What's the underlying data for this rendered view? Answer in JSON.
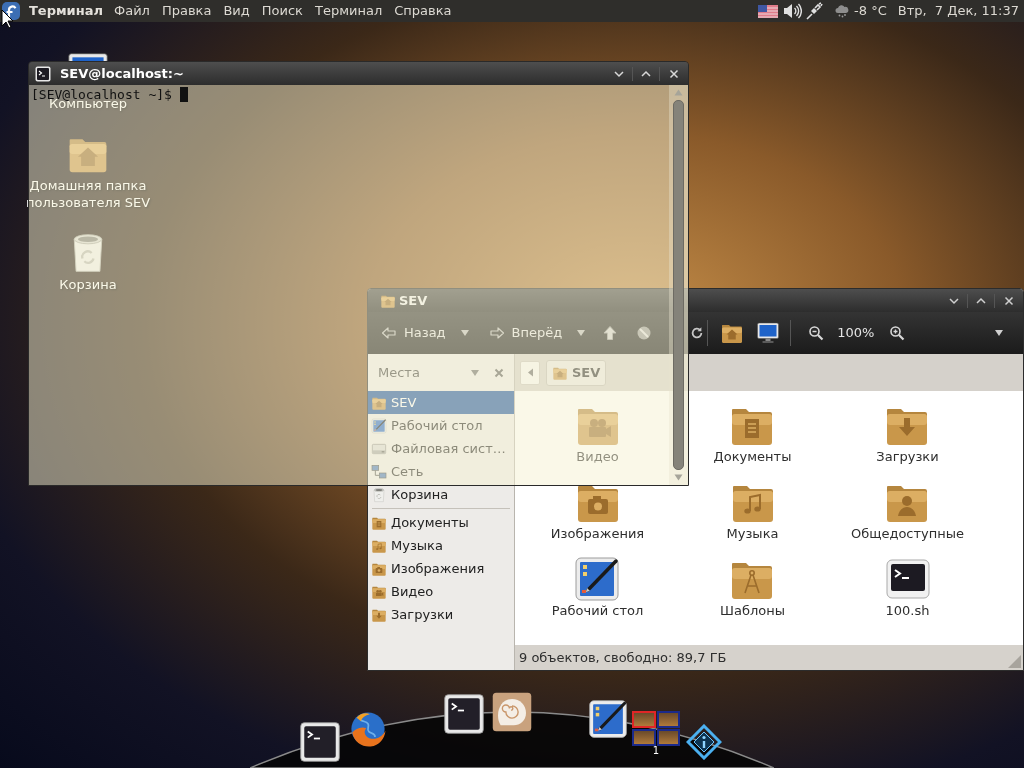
{
  "top_panel": {
    "app_name": "Терминал",
    "menu": [
      "Файл",
      "Правка",
      "Вид",
      "Поиск",
      "Терминал",
      "Справка"
    ],
    "temperature": "-8 °C",
    "clock": "Втр,  7 Дек, 11:37"
  },
  "desktop_icons": [
    {
      "kind": "computer",
      "label": "Компьютер"
    },
    {
      "kind": "home",
      "label": "Домашняя папка пользователя SEV"
    },
    {
      "kind": "trash",
      "label": "Корзина"
    }
  ],
  "terminal": {
    "title": "SEV@localhost:~",
    "prompt": "[SEV@localhost ~]$"
  },
  "file_manager": {
    "title": "SEV",
    "toolbar": {
      "back": "Назад",
      "forward": "Вперёд",
      "zoom": "100%"
    },
    "location": [
      {
        "kind": "home",
        "label": "SEV"
      }
    ],
    "sidebar": {
      "header": "Места",
      "places": [
        {
          "kind": "home",
          "label": "SEV",
          "selected": true
        },
        {
          "kind": "desktop",
          "label": "Рабочий стол",
          "selected": false
        },
        {
          "kind": "filesystem",
          "label": "Файловая сист…",
          "selected": false
        },
        {
          "kind": "network",
          "label": "Сеть",
          "selected": false
        },
        {
          "kind": "trash",
          "label": "Корзина",
          "selected": false
        }
      ],
      "bookmarks": [
        {
          "kind": "documents",
          "label": "Документы",
          "selected": false
        },
        {
          "kind": "music",
          "label": "Музыка",
          "selected": false
        },
        {
          "kind": "pictures",
          "label": "Изображения",
          "selected": false
        },
        {
          "kind": "videos",
          "label": "Видео",
          "selected": false
        },
        {
          "kind": "downloads",
          "label": "Загрузки",
          "selected": false
        }
      ]
    },
    "items": [
      {
        "kind": "videos",
        "label": "Видео"
      },
      {
        "kind": "documents",
        "label": "Документы"
      },
      {
        "kind": "downloads",
        "label": "Загрузки"
      },
      {
        "kind": "pictures",
        "label": "Изображения"
      },
      {
        "kind": "music",
        "label": "Музыка"
      },
      {
        "kind": "public",
        "label": "Общедоступные"
      },
      {
        "kind": "desktop",
        "label": "Рабочий стол"
      },
      {
        "kind": "templates",
        "label": "Шаблоны"
      },
      {
        "kind": "script",
        "label": "100.sh"
      }
    ],
    "status": "9 объектов, свободно: 89,7 ГБ"
  },
  "dock": {
    "items": [
      {
        "kind": "terminal"
      },
      {
        "kind": "browser"
      },
      {
        "kind": "terminal"
      },
      {
        "kind": "shell"
      },
      {
        "kind": "desktop"
      },
      {
        "kind": "pager",
        "label": "1",
        "workspaces": [
          {
            "selected": true
          },
          {
            "selected": false
          },
          {
            "selected": false
          },
          {
            "selected": false
          }
        ]
      },
      {
        "kind": "info"
      }
    ]
  }
}
